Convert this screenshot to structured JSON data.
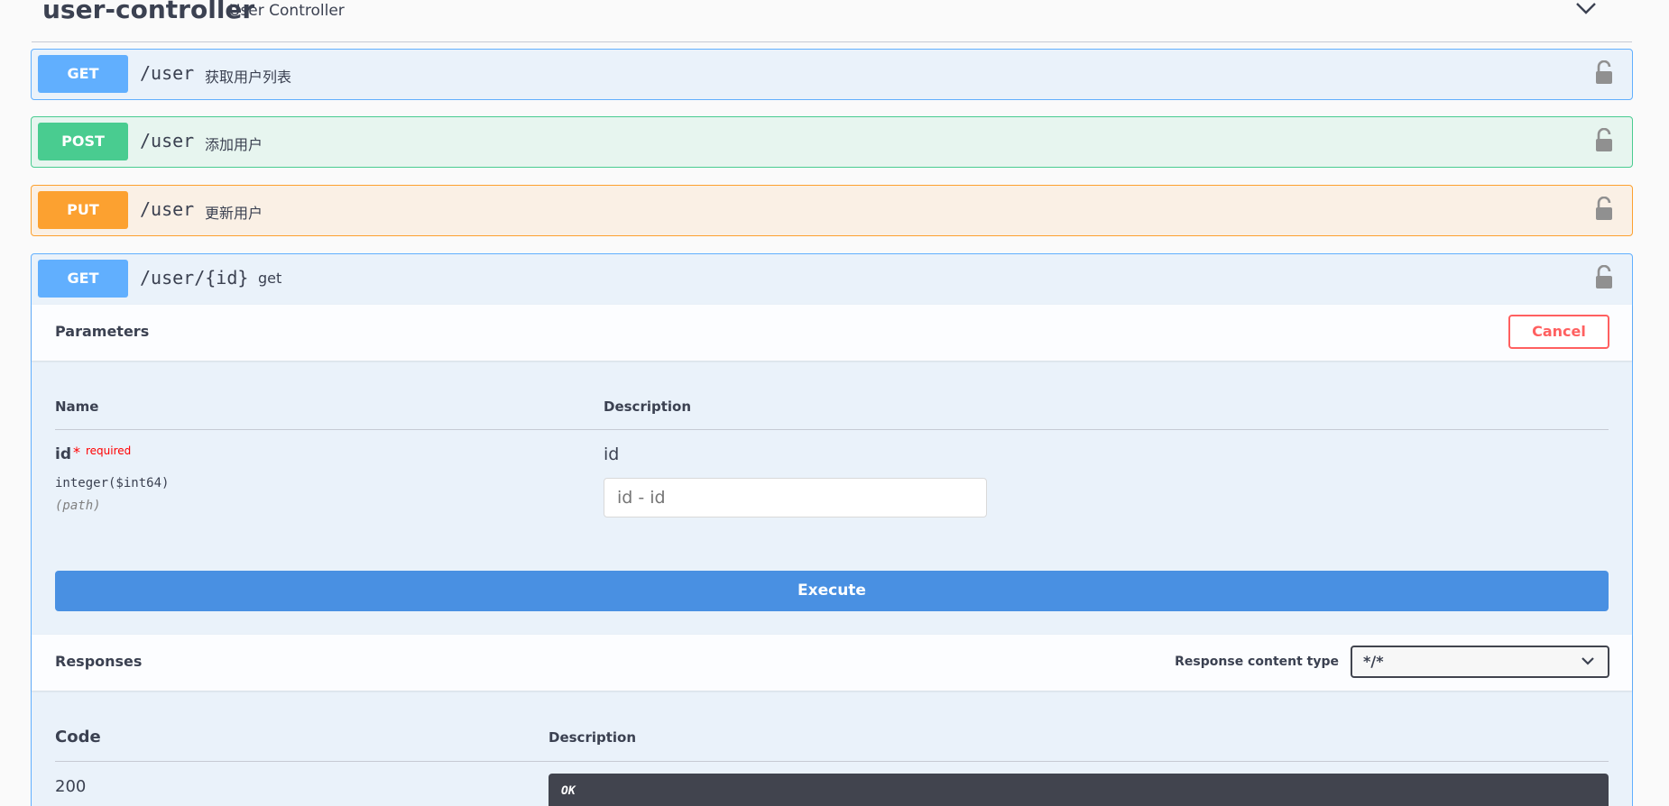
{
  "tag": {
    "title": "user-controller",
    "description": "User Controller",
    "chevron_icon": "chevron-down-icon"
  },
  "operations": [
    {
      "method": "GET",
      "path": "/user",
      "summary": "获取用户列表",
      "color": "#61affe"
    },
    {
      "method": "POST",
      "path": "/user",
      "summary": "添加用户",
      "color": "#49cc90"
    },
    {
      "method": "PUT",
      "path": "/user",
      "summary": "更新用户",
      "color": "#fca130"
    },
    {
      "method": "GET",
      "path": "/user/{id}",
      "summary": "get",
      "color": "#61affe"
    }
  ],
  "expanded": {
    "parameters_title": "Parameters",
    "cancel_label": "Cancel",
    "columns": {
      "name": "Name",
      "description": "Description"
    },
    "param": {
      "name": "id",
      "required_mark": "*",
      "required_label": "required",
      "type": "integer($int64)",
      "in": "(path)",
      "description": "id",
      "placeholder": "id - id"
    },
    "execute_label": "Execute",
    "responses_title": "Responses",
    "content_type_label": "Response content type",
    "content_type_value": "*/*",
    "response_columns": {
      "code": "Code",
      "description": "Description"
    },
    "response": {
      "code": "200",
      "description": "OK"
    }
  },
  "colors": {
    "cancel": "#ff6060",
    "execute": "#4990e2",
    "dark_box": "#41444e"
  }
}
